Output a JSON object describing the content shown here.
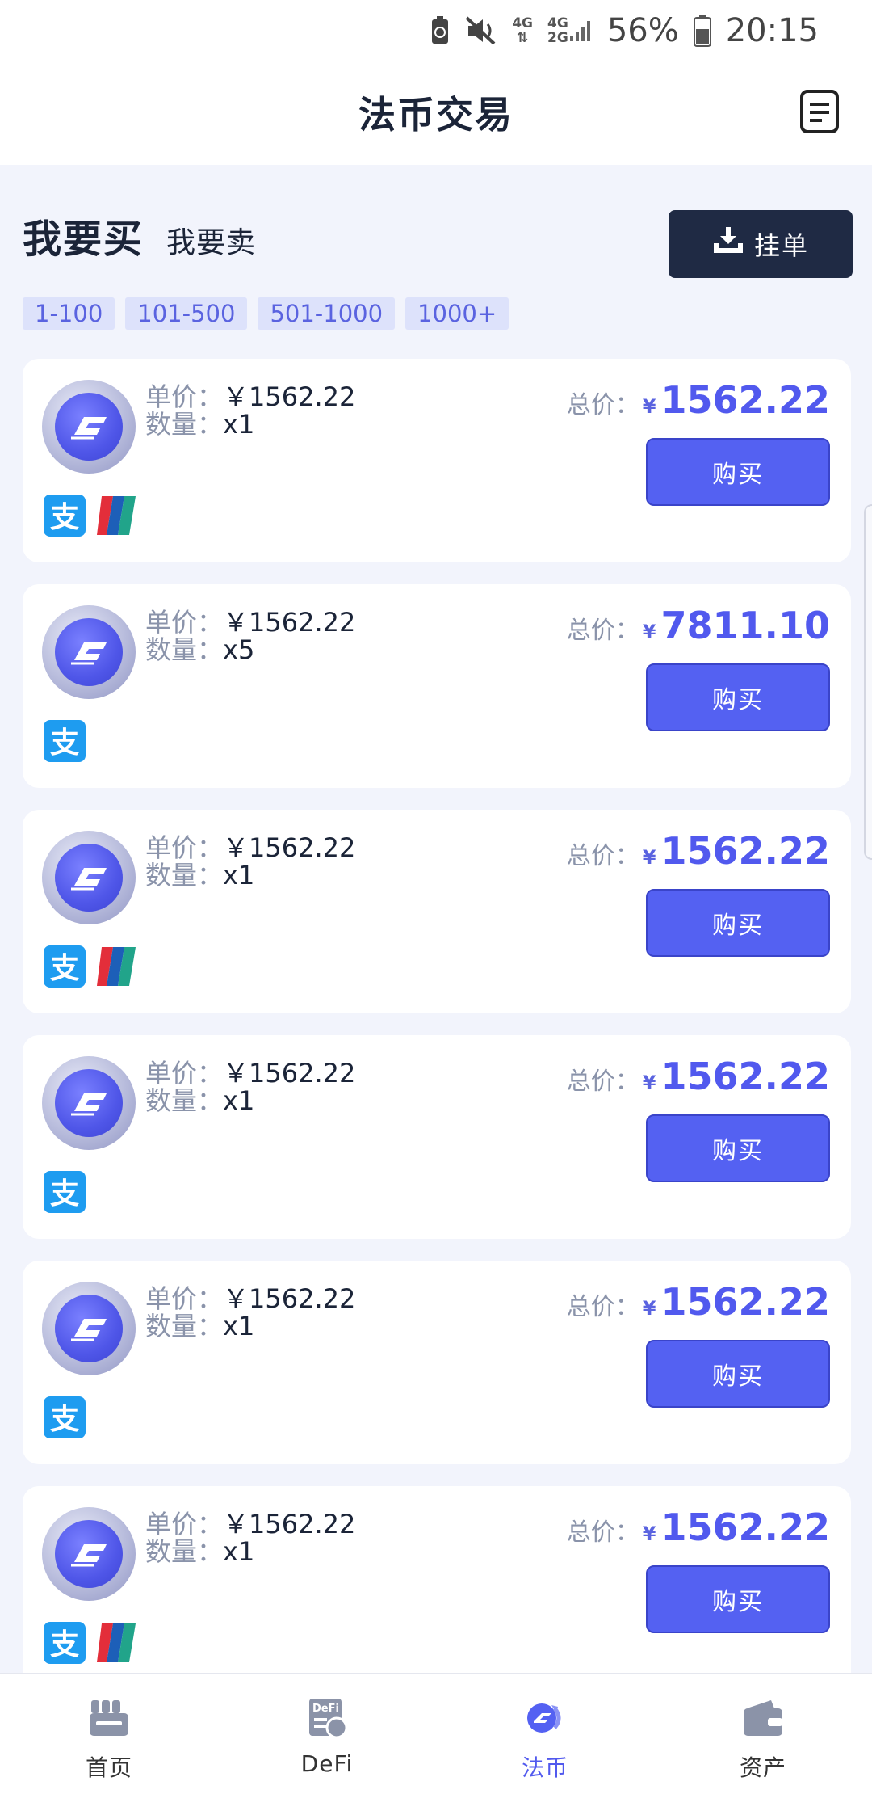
{
  "status_bar": {
    "net1_top": "4G",
    "net2_top": "4G",
    "net2_bottom": "2G",
    "battery": "56%",
    "time": "20:15"
  },
  "header": {
    "title": "法币交易",
    "orders_icon": "orders-list-icon"
  },
  "mode_tabs": {
    "buy": "我要买",
    "sell": "我要卖"
  },
  "post_button": {
    "label": "挂单",
    "icon": "download-tray-icon"
  },
  "filters": [
    "1-100",
    "101-500",
    "501-1000",
    "1000+"
  ],
  "colors": {
    "accent": "#5461f2",
    "dark": "#1f2a44",
    "chip_bg": "#dde2fb",
    "alipay": "#1e9cf0"
  },
  "listing_labels": {
    "unit_price": "单价：",
    "quantity": "数量：",
    "total": "总价：",
    "currency": "¥",
    "buy": "购买"
  },
  "listings": [
    {
      "unit_price": "￥1562.22",
      "quantity": "x1",
      "total": "1562.22",
      "payments": [
        "alipay",
        "unionpay"
      ]
    },
    {
      "unit_price": "￥1562.22",
      "quantity": "x5",
      "total": "7811.10",
      "payments": [
        "alipay"
      ]
    },
    {
      "unit_price": "￥1562.22",
      "quantity": "x1",
      "total": "1562.22",
      "payments": [
        "alipay",
        "unionpay"
      ]
    },
    {
      "unit_price": "￥1562.22",
      "quantity": "x1",
      "total": "1562.22",
      "payments": [
        "alipay"
      ]
    },
    {
      "unit_price": "￥1562.22",
      "quantity": "x1",
      "total": "1562.22",
      "payments": [
        "alipay"
      ]
    },
    {
      "unit_price": "￥1562.22",
      "quantity": "x1",
      "total": "1562.22",
      "payments": [
        "alipay",
        "unionpay"
      ]
    }
  ],
  "bottom_nav": [
    {
      "label": "首页",
      "icon": "home-icon",
      "active": false
    },
    {
      "label": "DeFi",
      "icon": "defi-icon",
      "active": false
    },
    {
      "label": "法币",
      "icon": "fiat-icon",
      "active": true
    },
    {
      "label": "资产",
      "icon": "wallet-icon",
      "active": false
    }
  ]
}
